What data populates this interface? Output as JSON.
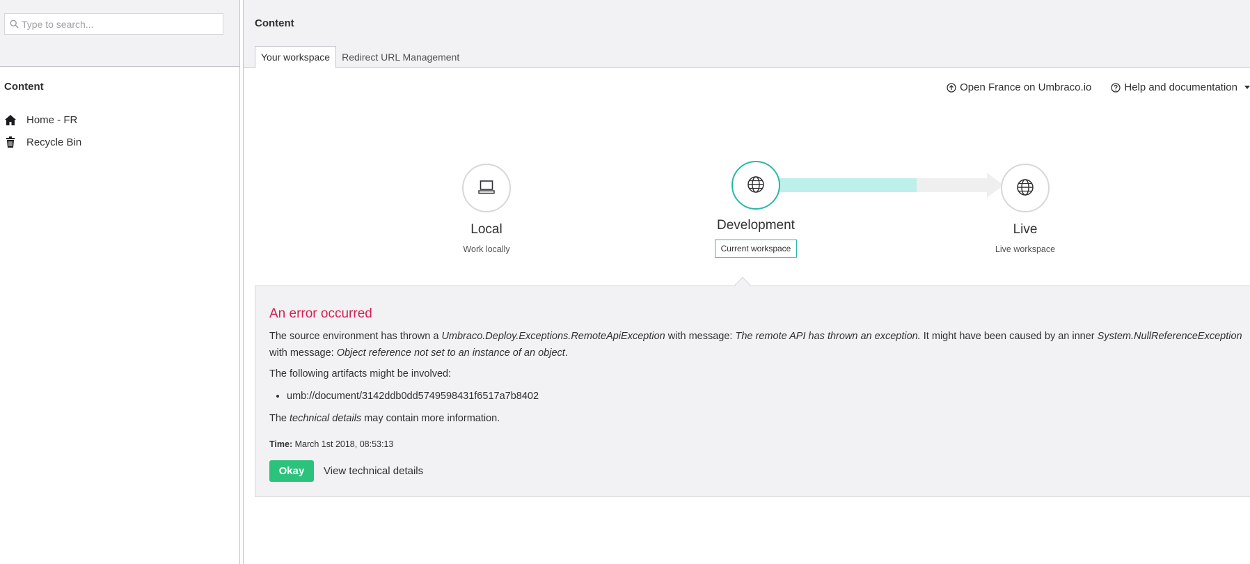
{
  "search": {
    "placeholder": "Type to search..."
  },
  "tree": {
    "heading": "Content",
    "items": [
      {
        "label": "Home - FR",
        "icon": "home-icon"
      },
      {
        "label": "Recycle Bin",
        "icon": "trash-icon"
      }
    ]
  },
  "main": {
    "title": "Content",
    "tabs": [
      {
        "label": "Your workspace",
        "active": true
      },
      {
        "label": "Redirect URL Management",
        "active": false
      }
    ],
    "links": {
      "open_cloud": "Open France on Umbraco.io",
      "help": "Help and documentation"
    }
  },
  "workflow": {
    "environments": [
      {
        "name": "Local",
        "description": "Work locally",
        "icon": "laptop-icon"
      },
      {
        "name": "Development",
        "badge": "Current workspace",
        "icon": "globe-icon"
      },
      {
        "name": "Live",
        "description": "Live workspace",
        "icon": "globe-icon"
      }
    ],
    "progress": 0.66
  },
  "error": {
    "title": "An error occurred",
    "msg_part1": "The source environment has thrown a ",
    "msg_exception": "Umbraco.Deploy.Exceptions.RemoteApiException",
    "msg_part2": " with message: ",
    "msg_remote": "The remote API has thrown an exception.",
    "msg_part3": " It might have been caused by an inner ",
    "msg_inner": "System.NullReferenceException",
    "msg_part4": " with message: ",
    "msg_object": "Object reference not set to an instance of an object",
    "msg_part5": ".",
    "artifacts_label": "The following artifacts might be involved:",
    "artifacts": [
      "umb://document/3142ddb0dd5749598431f6517a7b8402"
    ],
    "more_part1": "The ",
    "more_italic": "technical details",
    "more_part2": " may contain more information.",
    "time_label": "Time:",
    "time_value": " March 1st 2018, 08:53:13",
    "okay_label": "Okay",
    "details_label": "View technical details"
  },
  "colors": {
    "accent": "#2bb7a8",
    "error": "#d42054",
    "success": "#2bc37c",
    "progress_fill": "#bdefeb"
  }
}
